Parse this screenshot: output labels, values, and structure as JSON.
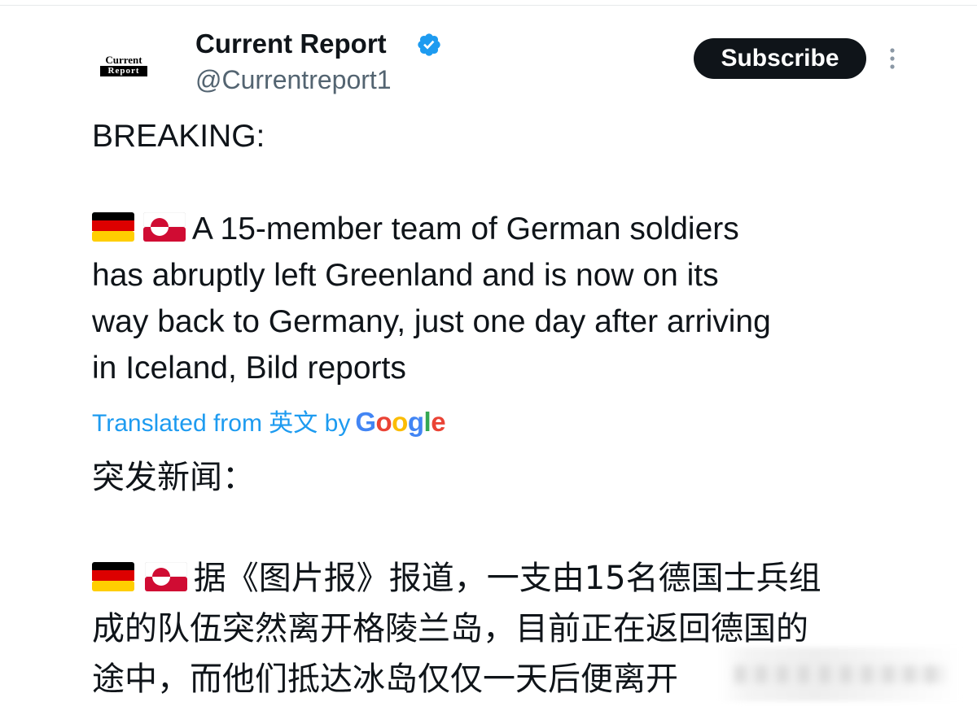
{
  "account": {
    "logo_top": "Current",
    "logo_bottom": "Report",
    "display_name": "Current Report",
    "handle": "@Currentreport1",
    "verified": true
  },
  "actions": {
    "subscribe_label": "Subscribe",
    "more_icon": "more-vertical-icon"
  },
  "tweet": {
    "lines": [
      "BREAKING:",
      "",
      "A 15-member team of German soldiers",
      "has abruptly left Greenland and is now on its",
      "way back to Germany, just one day after arriving",
      "in Iceland, Bild reports"
    ],
    "flags": [
      "germany-flag-icon",
      "greenland-flag-icon"
    ]
  },
  "translation": {
    "label": "Translated from 英文 by",
    "provider": "Google",
    "lines": [
      "突发新闻：",
      "",
      "据《图片报》报道，一支由15名德国士兵组",
      "成的队伍突然离开格陵兰岛，目前正在返回德国的",
      "途中，而他们抵达冰岛仅仅一天后便离开"
    ]
  },
  "colors": {
    "text_primary": "#0f1419",
    "text_secondary": "#536471",
    "accent": "#1d9bf0",
    "button_bg": "#0f1419"
  }
}
